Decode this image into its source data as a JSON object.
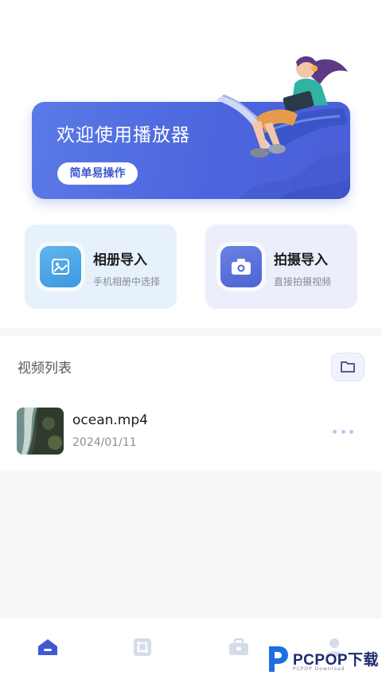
{
  "banner": {
    "title": "欢迎使用播放器",
    "button_label": "简单易操作"
  },
  "import_cards": [
    {
      "title": "相册导入",
      "subtitle": "手机相册中选择",
      "icon": "image-icon"
    },
    {
      "title": "拍摄导入",
      "subtitle": "直接拍摄视频",
      "icon": "camera-icon"
    }
  ],
  "video_list": {
    "title": "视频列表",
    "folder_icon": "folder-icon",
    "items": [
      {
        "name": "ocean.mp4",
        "date": "2024/01/11"
      }
    ]
  },
  "tabbar": {
    "tabs": [
      {
        "icon": "home-icon",
        "active": true
      },
      {
        "icon": "crop-icon",
        "active": false
      },
      {
        "icon": "toolbox-icon",
        "active": false
      },
      {
        "icon": "profile-icon",
        "active": false
      }
    ]
  },
  "watermark": {
    "text": "PCPOP下载",
    "sub": "PCPOP Download"
  },
  "colors": {
    "accent": "#4b64dd",
    "album_card_bg": "#e6f1fb",
    "camera_card_bg": "#eceefb",
    "tab_inactive": "#d6dbea"
  }
}
